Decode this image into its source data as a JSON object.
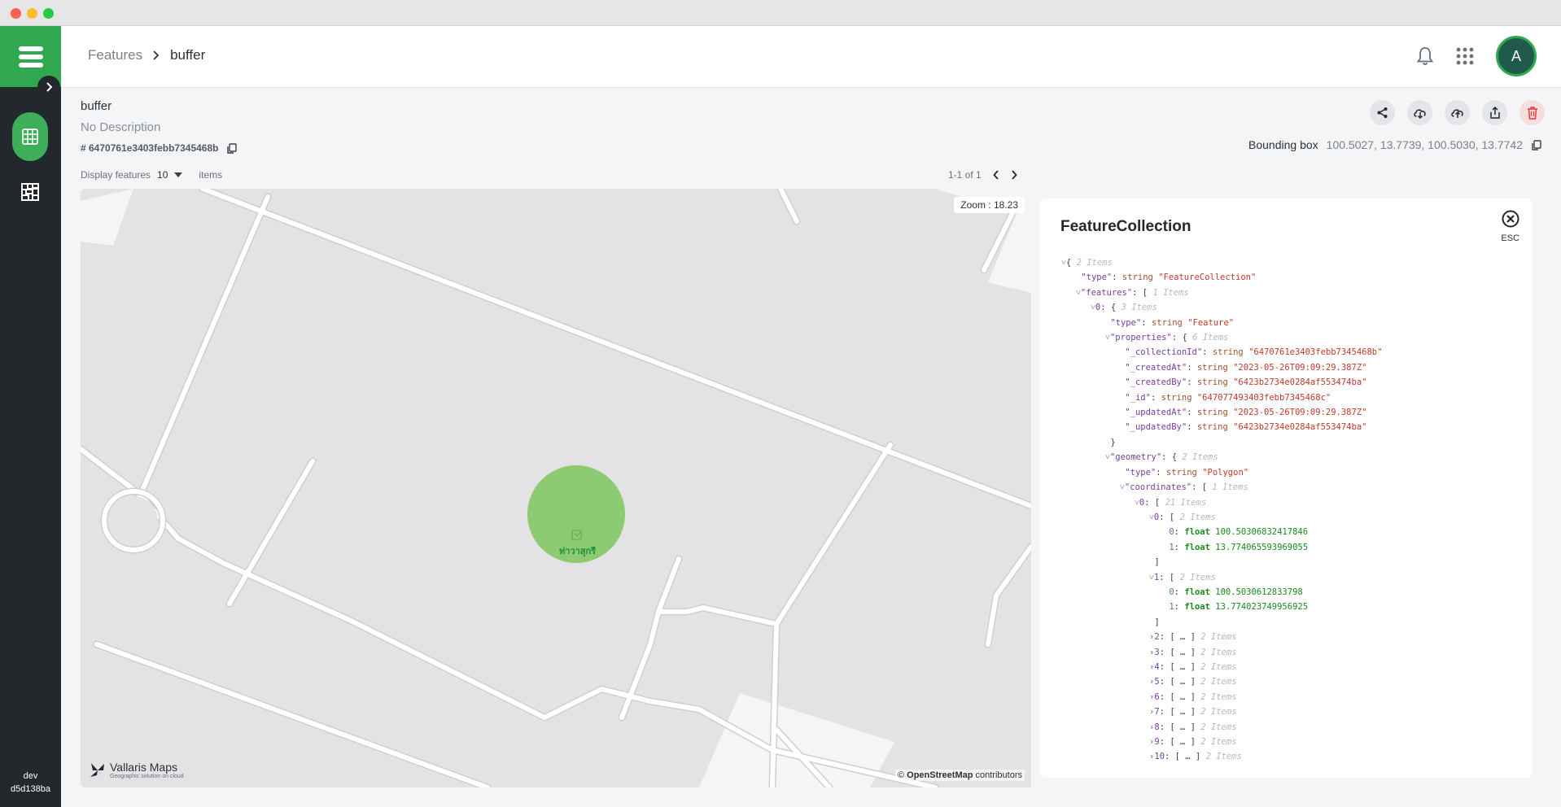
{
  "window": {
    "traffic_lights": [
      "close",
      "minimize",
      "zoom"
    ]
  },
  "sidebar": {
    "env_label": "dev",
    "env_code": "d5d138ba",
    "items": [
      {
        "icon": "table-icon",
        "active": true
      },
      {
        "icon": "tiles-icon",
        "active": false
      }
    ]
  },
  "header": {
    "breadcrumb_root": "Features",
    "breadcrumb_current": "buffer",
    "avatar_initial": "A"
  },
  "collection": {
    "name": "buffer",
    "description": "No Description",
    "id": "# 6470761e3403febb7345468b",
    "bbox_label": "Bounding box",
    "bbox_value": "100.5027, 13.7739, 100.5030, 13.7742"
  },
  "controls": {
    "display_label": "Display features",
    "display_count": "10",
    "items_label": "items",
    "pager": "1-1 of 1"
  },
  "map": {
    "zoom": "Zoom : 18.23",
    "brand": "Vallaris Maps",
    "brand_tagline": "Geographic solution on cloud",
    "attribution_prefix": "©",
    "attribution_link": "OpenStreetMap",
    "attribution_suffix": "contributors",
    "place_label": "ท่าวาสุกรี",
    "colors": {
      "buffer_fill": "#8ccb71",
      "road": "#ffffff",
      "land": "#e3e3e5"
    }
  },
  "panel": {
    "title": "FeatureCollection",
    "close_hint": "ESC",
    "lines": [
      {
        "i": 0,
        "ch": "v",
        "t": "{",
        "c": "2 Items"
      },
      {
        "i": 1,
        "k": "\"type\"",
        "ty": "string",
        "sv": "\"FeatureCollection\""
      },
      {
        "i": 1,
        "ch": "v",
        "k": "\"features\"",
        "t": "[",
        "c": "1 Items"
      },
      {
        "i": 2,
        "ch": "v",
        "k": "0",
        "t": "{",
        "c": "3 Items"
      },
      {
        "i": 3,
        "k": "\"type\"",
        "ty": "string",
        "sv": "\"Feature\""
      },
      {
        "i": 3,
        "ch": "v",
        "k": "\"properties\"",
        "t": "{",
        "c": "6 Items"
      },
      {
        "i": 4,
        "k": "\"_collectionId\"",
        "ty": "string",
        "sv": "\"6470761e3403febb7345468b\""
      },
      {
        "i": 4,
        "k": "\"_createdAt\"",
        "ty": "string",
        "sv": "\"2023-05-26T09:09:29.387Z\""
      },
      {
        "i": 4,
        "k": "\"_createdBy\"",
        "ty": "string",
        "sv": "\"6423b2734e0284af553474ba\""
      },
      {
        "i": 4,
        "k": "\"_id\"",
        "ty": "string",
        "sv": "\"647077493403febb7345468c\""
      },
      {
        "i": 4,
        "k": "\"_updatedAt\"",
        "ty": "string",
        "sv": "\"2023-05-26T09:09:29.387Z\""
      },
      {
        "i": 4,
        "k": "\"_updatedBy\"",
        "ty": "string",
        "sv": "\"6423b2734e0284af553474ba\""
      },
      {
        "i": 3,
        "t": "}"
      },
      {
        "i": 3,
        "ch": "v",
        "k": "\"geometry\"",
        "t": "{",
        "c": "2 Items"
      },
      {
        "i": 4,
        "k": "\"type\"",
        "ty": "string",
        "sv": "\"Polygon\""
      },
      {
        "i": 4,
        "ch": "v",
        "k": "\"coordinates\"",
        "t": "[",
        "c": "1 Items"
      },
      {
        "i": 5,
        "ch": "v",
        "k": "0",
        "t": "[",
        "c": "21 Items"
      },
      {
        "i": 6,
        "ch": "v",
        "k": "0",
        "t": "[",
        "c": "2 Items"
      },
      {
        "i": 7,
        "ix": "0",
        "ft": "float",
        "fl": "100.50306832417846"
      },
      {
        "i": 7,
        "ix": "1",
        "ft": "float",
        "fl": "13.774065593969055"
      },
      {
        "i": 6,
        "t": "]"
      },
      {
        "i": 6,
        "ch": "v",
        "k": "1",
        "t": "[",
        "c": "2 Items"
      },
      {
        "i": 7,
        "ix": "0",
        "ft": "float",
        "fl": "100.5030612833798"
      },
      {
        "i": 7,
        "ix": "1",
        "ft": "float",
        "fl": "13.774023749956925"
      },
      {
        "i": 6,
        "t": "]"
      },
      {
        "i": 6,
        "ch": ">",
        "k": "2",
        "t": "[ … ]",
        "c": "2 Items"
      },
      {
        "i": 6,
        "ch": ">",
        "k": "3",
        "t": "[ … ]",
        "c": "2 Items"
      },
      {
        "i": 6,
        "ch": ">",
        "k": "4",
        "t": "[ … ]",
        "c": "2 Items"
      },
      {
        "i": 6,
        "ch": ">",
        "k": "5",
        "t": "[ … ]",
        "c": "2 Items"
      },
      {
        "i": 6,
        "ch": ">",
        "k": "6",
        "t": "[ … ]",
        "c": "2 Items"
      },
      {
        "i": 6,
        "ch": ">",
        "k": "7",
        "t": "[ … ]",
        "c": "2 Items"
      },
      {
        "i": 6,
        "ch": ">",
        "k": "8",
        "t": "[ … ]",
        "c": "2 Items"
      },
      {
        "i": 6,
        "ch": ">",
        "k": "9",
        "t": "[ … ]",
        "c": "2 Items"
      },
      {
        "i": 6,
        "ch": ">",
        "k": "10",
        "t": "[ … ]",
        "c": "2 Items"
      }
    ]
  }
}
